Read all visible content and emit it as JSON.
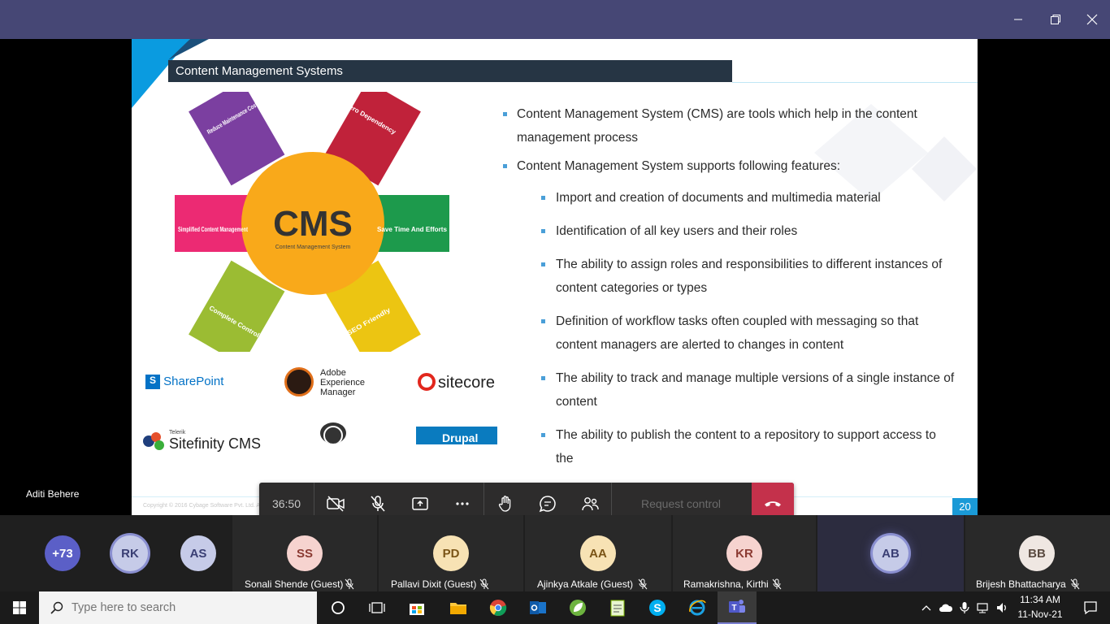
{
  "slide": {
    "title": "Content Management Systems",
    "bullets": [
      "Content Management System (CMS) are tools which help in the content management process",
      "Content Management System  supports following features:"
    ],
    "sub_bullets": [
      "Import and creation of documents and multimedia material",
      "Identification of all key users and their roles",
      "The ability to assign roles and responsibilities to different instances of content categories or types",
      "Definition of workflow tasks often coupled with messaging so that content managers are alerted to changes in content",
      "The ability to track and manage multiple versions of a single instance of content",
      "The ability to publish the content to a repository to support access to the"
    ],
    "diagram": {
      "center_title": "CMS",
      "center_subtitle": "Content Management System",
      "petals": {
        "reduce": "Reduce Maintenance Cost",
        "zero": "Zero Dependency",
        "save": "Save Time And Efforts",
        "seo": "SEO Friendly",
        "complete": "Complete Control",
        "simplified": "Simplified Content Management"
      }
    },
    "logos": {
      "sharepoint": "SharePoint",
      "adobe_line1": "Adobe",
      "adobe_line2": "Experience",
      "adobe_line3": "Manager",
      "sitecore": "sitecore",
      "sitefinity_small": "Telerik",
      "sitefinity": "Sitefinity CMS",
      "drupal": "Drupal"
    },
    "copyright": "Copyright © 2016 Cybage Software Pvt. Ltd. All Rights Reserved. Cybage Confidential",
    "page_number": "20"
  },
  "presenter": "Aditi Behere",
  "controls": {
    "timer": "36:50",
    "request_control": "Request control"
  },
  "participants": {
    "overflow": "+73",
    "small": [
      "RK",
      "AS"
    ],
    "tiles": [
      {
        "initials": "SS",
        "name": "Sonali Shende (Guest)",
        "color": "#f6d3cf",
        "text": "#8b3a32"
      },
      {
        "initials": "PD",
        "name": "Pallavi Dixit (Guest)",
        "color": "#f7e2b4",
        "text": "#7a5416"
      },
      {
        "initials": "AA",
        "name": "Ajinkya Atkale (Guest)",
        "color": "#f7e2b4",
        "text": "#7a5416"
      },
      {
        "initials": "KR",
        "name": "Ramakrishna, Kirthi",
        "color": "#f6d3cf",
        "text": "#8b3a32"
      },
      {
        "initials": "AB",
        "name": "",
        "color": "#c6cbe8",
        "text": "#3a3f74"
      },
      {
        "initials": "BB",
        "name": "Brijesh Bhattacharya",
        "color": "#efe7e2",
        "text": "#5a4a40"
      }
    ]
  },
  "taskbar": {
    "search_placeholder": "Type here to search",
    "time": "11:34 AM",
    "date": "11-Nov-21"
  },
  "colors": {
    "titlebar": "#464775",
    "teams_purple": "#6264a7",
    "hangup": "#c4314b",
    "accent_blue": "#1a9ad7"
  }
}
